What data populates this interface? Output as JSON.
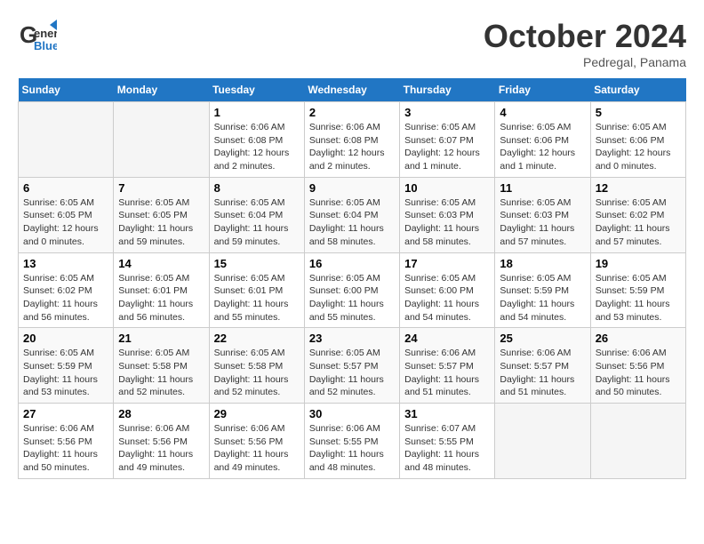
{
  "header": {
    "logo_general": "General",
    "logo_blue": "Blue",
    "month": "October 2024",
    "location": "Pedregal, Panama"
  },
  "days_of_week": [
    "Sunday",
    "Monday",
    "Tuesday",
    "Wednesday",
    "Thursday",
    "Friday",
    "Saturday"
  ],
  "weeks": [
    [
      {
        "day": "",
        "info": ""
      },
      {
        "day": "",
        "info": ""
      },
      {
        "day": "1",
        "sunrise": "Sunrise: 6:06 AM",
        "sunset": "Sunset: 6:08 PM",
        "daylight": "Daylight: 12 hours and 2 minutes."
      },
      {
        "day": "2",
        "sunrise": "Sunrise: 6:06 AM",
        "sunset": "Sunset: 6:08 PM",
        "daylight": "Daylight: 12 hours and 2 minutes."
      },
      {
        "day": "3",
        "sunrise": "Sunrise: 6:05 AM",
        "sunset": "Sunset: 6:07 PM",
        "daylight": "Daylight: 12 hours and 1 minute."
      },
      {
        "day": "4",
        "sunrise": "Sunrise: 6:05 AM",
        "sunset": "Sunset: 6:06 PM",
        "daylight": "Daylight: 12 hours and 1 minute."
      },
      {
        "day": "5",
        "sunrise": "Sunrise: 6:05 AM",
        "sunset": "Sunset: 6:06 PM",
        "daylight": "Daylight: 12 hours and 0 minutes."
      }
    ],
    [
      {
        "day": "6",
        "sunrise": "Sunrise: 6:05 AM",
        "sunset": "Sunset: 6:05 PM",
        "daylight": "Daylight: 12 hours and 0 minutes."
      },
      {
        "day": "7",
        "sunrise": "Sunrise: 6:05 AM",
        "sunset": "Sunset: 6:05 PM",
        "daylight": "Daylight: 11 hours and 59 minutes."
      },
      {
        "day": "8",
        "sunrise": "Sunrise: 6:05 AM",
        "sunset": "Sunset: 6:04 PM",
        "daylight": "Daylight: 11 hours and 59 minutes."
      },
      {
        "day": "9",
        "sunrise": "Sunrise: 6:05 AM",
        "sunset": "Sunset: 6:04 PM",
        "daylight": "Daylight: 11 hours and 58 minutes."
      },
      {
        "day": "10",
        "sunrise": "Sunrise: 6:05 AM",
        "sunset": "Sunset: 6:03 PM",
        "daylight": "Daylight: 11 hours and 58 minutes."
      },
      {
        "day": "11",
        "sunrise": "Sunrise: 6:05 AM",
        "sunset": "Sunset: 6:03 PM",
        "daylight": "Daylight: 11 hours and 57 minutes."
      },
      {
        "day": "12",
        "sunrise": "Sunrise: 6:05 AM",
        "sunset": "Sunset: 6:02 PM",
        "daylight": "Daylight: 11 hours and 57 minutes."
      }
    ],
    [
      {
        "day": "13",
        "sunrise": "Sunrise: 6:05 AM",
        "sunset": "Sunset: 6:02 PM",
        "daylight": "Daylight: 11 hours and 56 minutes."
      },
      {
        "day": "14",
        "sunrise": "Sunrise: 6:05 AM",
        "sunset": "Sunset: 6:01 PM",
        "daylight": "Daylight: 11 hours and 56 minutes."
      },
      {
        "day": "15",
        "sunrise": "Sunrise: 6:05 AM",
        "sunset": "Sunset: 6:01 PM",
        "daylight": "Daylight: 11 hours and 55 minutes."
      },
      {
        "day": "16",
        "sunrise": "Sunrise: 6:05 AM",
        "sunset": "Sunset: 6:00 PM",
        "daylight": "Daylight: 11 hours and 55 minutes."
      },
      {
        "day": "17",
        "sunrise": "Sunrise: 6:05 AM",
        "sunset": "Sunset: 6:00 PM",
        "daylight": "Daylight: 11 hours and 54 minutes."
      },
      {
        "day": "18",
        "sunrise": "Sunrise: 6:05 AM",
        "sunset": "Sunset: 5:59 PM",
        "daylight": "Daylight: 11 hours and 54 minutes."
      },
      {
        "day": "19",
        "sunrise": "Sunrise: 6:05 AM",
        "sunset": "Sunset: 5:59 PM",
        "daylight": "Daylight: 11 hours and 53 minutes."
      }
    ],
    [
      {
        "day": "20",
        "sunrise": "Sunrise: 6:05 AM",
        "sunset": "Sunset: 5:59 PM",
        "daylight": "Daylight: 11 hours and 53 minutes."
      },
      {
        "day": "21",
        "sunrise": "Sunrise: 6:05 AM",
        "sunset": "Sunset: 5:58 PM",
        "daylight": "Daylight: 11 hours and 52 minutes."
      },
      {
        "day": "22",
        "sunrise": "Sunrise: 6:05 AM",
        "sunset": "Sunset: 5:58 PM",
        "daylight": "Daylight: 11 hours and 52 minutes."
      },
      {
        "day": "23",
        "sunrise": "Sunrise: 6:05 AM",
        "sunset": "Sunset: 5:57 PM",
        "daylight": "Daylight: 11 hours and 52 minutes."
      },
      {
        "day": "24",
        "sunrise": "Sunrise: 6:06 AM",
        "sunset": "Sunset: 5:57 PM",
        "daylight": "Daylight: 11 hours and 51 minutes."
      },
      {
        "day": "25",
        "sunrise": "Sunrise: 6:06 AM",
        "sunset": "Sunset: 5:57 PM",
        "daylight": "Daylight: 11 hours and 51 minutes."
      },
      {
        "day": "26",
        "sunrise": "Sunrise: 6:06 AM",
        "sunset": "Sunset: 5:56 PM",
        "daylight": "Daylight: 11 hours and 50 minutes."
      }
    ],
    [
      {
        "day": "27",
        "sunrise": "Sunrise: 6:06 AM",
        "sunset": "Sunset: 5:56 PM",
        "daylight": "Daylight: 11 hours and 50 minutes."
      },
      {
        "day": "28",
        "sunrise": "Sunrise: 6:06 AM",
        "sunset": "Sunset: 5:56 PM",
        "daylight": "Daylight: 11 hours and 49 minutes."
      },
      {
        "day": "29",
        "sunrise": "Sunrise: 6:06 AM",
        "sunset": "Sunset: 5:56 PM",
        "daylight": "Daylight: 11 hours and 49 minutes."
      },
      {
        "day": "30",
        "sunrise": "Sunrise: 6:06 AM",
        "sunset": "Sunset: 5:55 PM",
        "daylight": "Daylight: 11 hours and 48 minutes."
      },
      {
        "day": "31",
        "sunrise": "Sunrise: 6:07 AM",
        "sunset": "Sunset: 5:55 PM",
        "daylight": "Daylight: 11 hours and 48 minutes."
      },
      {
        "day": "",
        "info": ""
      },
      {
        "day": "",
        "info": ""
      }
    ]
  ]
}
